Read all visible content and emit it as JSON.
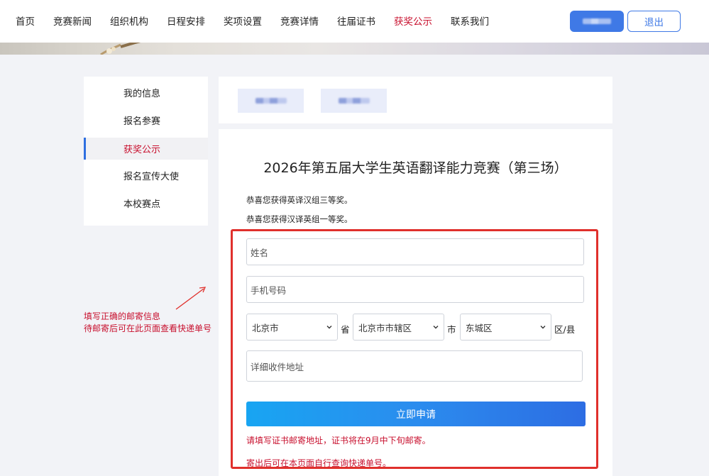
{
  "nav": {
    "items": [
      "首页",
      "竞赛新闻",
      "组织机构",
      "日程安排",
      "奖项设置",
      "竞赛详情",
      "往届证书",
      "获奖公示",
      "联系我们"
    ],
    "active_index": 7
  },
  "header": {
    "logout_label": "退出"
  },
  "sidebar": {
    "items": [
      {
        "label": "我的信息"
      },
      {
        "label": "报名参赛"
      },
      {
        "label": "获奖公示"
      },
      {
        "label": "报名宣传大使"
      },
      {
        "label": "本校赛点"
      }
    ],
    "active_index": 2
  },
  "main": {
    "title": "2026年第五届大学生英语翻译能力竞赛（第三场）",
    "messages": [
      "恭喜您获得英译汉组三等奖。",
      "恭喜您获得汉译英组一等奖。"
    ]
  },
  "form": {
    "name_placeholder": "姓名",
    "phone_placeholder": "手机号码",
    "province": "北京市",
    "province_unit": "省",
    "city": "北京市市辖区",
    "city_unit": "市",
    "district": "东城区",
    "district_unit": "区/县",
    "address_placeholder": "详细收件地址",
    "submit_label": "立即申请",
    "notes": [
      "请填写证书邮寄地址，证书将在9月中下旬邮寄。",
      "寄出后可在本页面自行查询快递单号。"
    ]
  },
  "annotation": {
    "lines": [
      "填写正确的邮寄信息",
      "待邮寄后可在此页面查看快递单号"
    ]
  },
  "colors": {
    "accent_red": "#c8102e",
    "primary_blue": "#3f79e6",
    "highlight_border": "#e0302c"
  }
}
